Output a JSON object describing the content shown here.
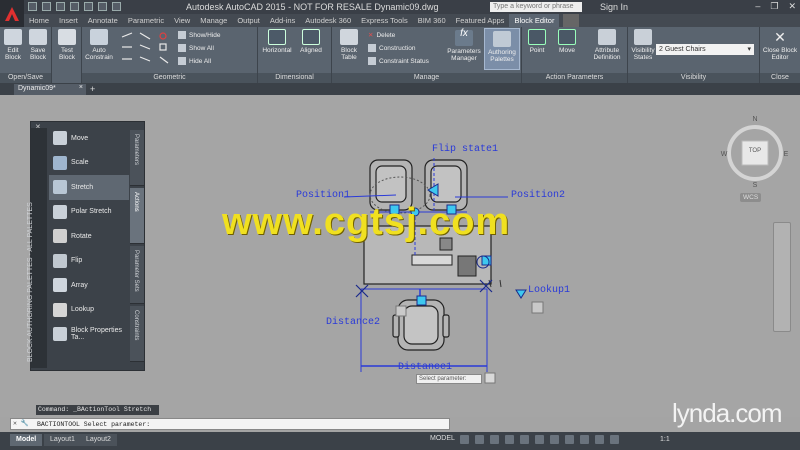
{
  "app": {
    "title": "Autodesk AutoCAD 2015 - NOT FOR RESALE    Dynamic09.dwg",
    "search_placeholder": "Type a keyword or phrase",
    "signin": "Sign In"
  },
  "ribbon_tabs": [
    "Home",
    "Insert",
    "Annotate",
    "Parametric",
    "View",
    "Manage",
    "Output",
    "Add-ins",
    "Autodesk 360",
    "Express Tools",
    "BIM 360",
    "Featured Apps",
    "Block Editor"
  ],
  "active_ribbon_tab": "Block Editor",
  "ribbon": {
    "open_save": {
      "title": "Open/Save",
      "edit_block": "Edit Block",
      "save_block": "Save Block"
    },
    "test_block": "Test Block",
    "auto_constrain": "Auto Constrain",
    "geometric_title": "Geometric",
    "show_hide": "Show/Hide",
    "show_all": "Show All",
    "hide_all": "Hide All",
    "dimensional": {
      "title": "Dimensional",
      "horizontal": "Horizontal",
      "aligned": "Aligned"
    },
    "manage": {
      "title": "Manage",
      "block_table": "Block Table",
      "delete": "Delete",
      "construction": "Construction",
      "constraint_status": "Constraint Status",
      "parameters_manager": "Parameters Manager",
      "authoring_palettes": "Authoring Palettes"
    },
    "action_parameters": {
      "title": "Action Parameters",
      "point": "Point",
      "move": "Move",
      "attribute_definition": "Attribute Definition"
    },
    "visibility": {
      "title": "Visibility",
      "visibility_states": "Visibility States",
      "selected_state": "2 Guest Chairs"
    },
    "close": {
      "title": "Close",
      "close_block_editor": "Close Block Editor"
    }
  },
  "file_tab": "Dynamic09*",
  "palette": {
    "title": "BLOCK AUTHORING PALETTES - ALL PALETTES",
    "items": [
      "Move",
      "Scale",
      "Stretch",
      "Polar Stretch",
      "Rotate",
      "Flip",
      "Array",
      "Lookup",
      "Block Properties Ta..."
    ],
    "selected_item": "Stretch",
    "tabs": [
      "Parameters",
      "Actions",
      "Parameter Sets",
      "Constraints"
    ],
    "selected_tab": "Actions"
  },
  "drawing": {
    "flip_state": "Flip state1",
    "position1": "Position1",
    "position2": "Position2",
    "lookup1": "Lookup1",
    "distance2": "Distance2",
    "distance1": "Distance1",
    "select_tooltip": "Select parameter:",
    "watermark": "www.cgtsj.com",
    "viewcube_top": "TOP",
    "wcs": "WCS"
  },
  "command": {
    "history": "Command: _BActionTool Stretch",
    "prompt": "BACTIONTOOL Select parameter:"
  },
  "status": {
    "layout_tabs": [
      "Model",
      "Layout1",
      "Layout2"
    ],
    "active_layout": "Model",
    "model_label": "MODEL",
    "scale": "1:1"
  },
  "branding": "lynda.com",
  "colors": {
    "param_blue": "#2a3ad8",
    "grip_cyan": "#3ec8ef",
    "watermark_yellow": "#f0e020",
    "ribbon_bg": "#5a646f"
  }
}
